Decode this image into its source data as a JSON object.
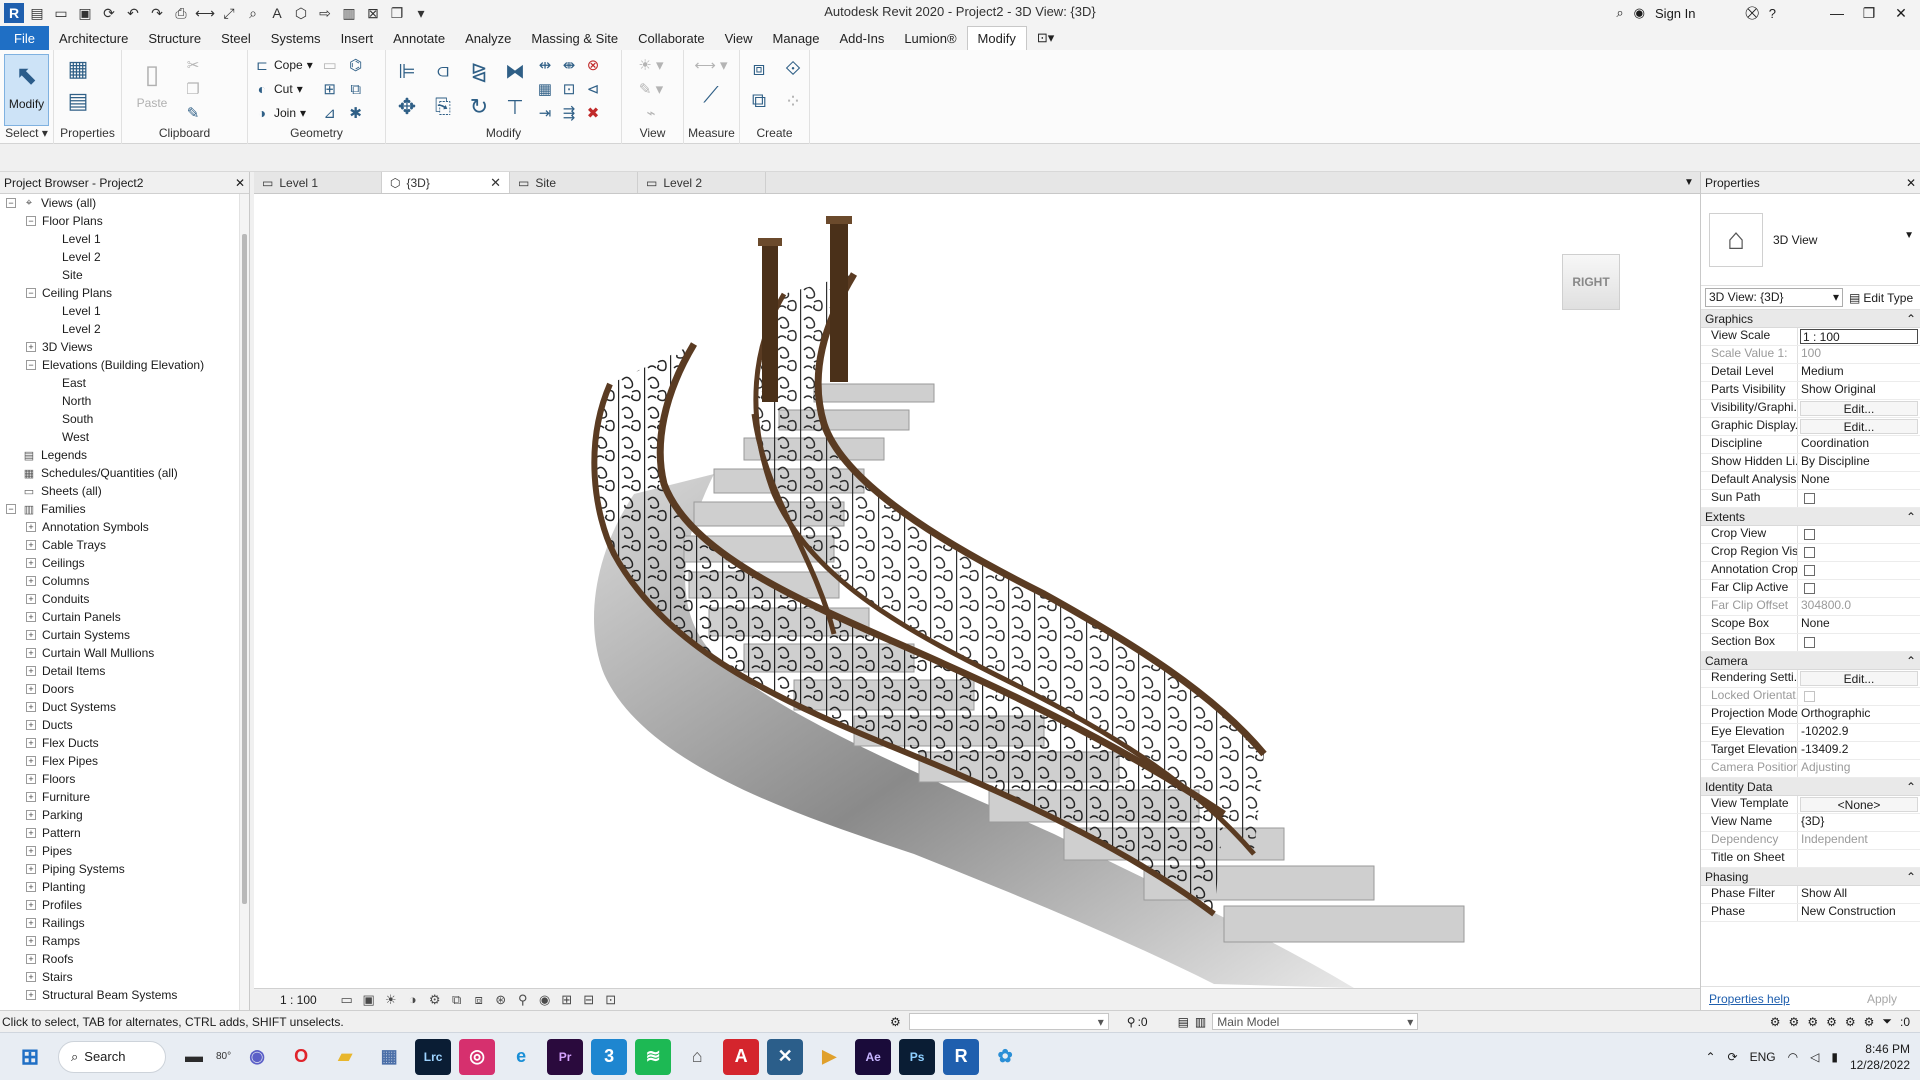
{
  "titlebar": {
    "title": "Autodesk Revit 2020 - Project2 - 3D View: {3D}",
    "sign_in": "Sign In"
  },
  "menu": {
    "file": "File",
    "tabs": [
      "Architecture",
      "Structure",
      "Steel",
      "Systems",
      "Insert",
      "Annotate",
      "Analyze",
      "Massing & Site",
      "Collaborate",
      "View",
      "Manage",
      "Add-Ins",
      "Lumion®",
      "Modify"
    ]
  },
  "ribbon": {
    "select": {
      "modify": "Modify",
      "label": "Select"
    },
    "properties": {
      "button": "Properties"
    },
    "clipboard": {
      "paste": "Paste",
      "label": "Clipboard"
    },
    "geometry": {
      "cope": "Cope",
      "cut": "Cut",
      "join": "Join",
      "label": "Geometry"
    },
    "modify": {
      "label": "Modify"
    },
    "view": {
      "label": "View"
    },
    "measure": {
      "label": "Measure"
    },
    "create": {
      "label": "Create"
    }
  },
  "project_browser": {
    "title": "Project Browser - Project2",
    "items": [
      {
        "label": "Views (all)",
        "level": 0,
        "toggle": "−",
        "icon": "views"
      },
      {
        "label": "Floor Plans",
        "level": 1,
        "toggle": "−"
      },
      {
        "label": "Level 1",
        "level": 2
      },
      {
        "label": "Level 2",
        "level": 2
      },
      {
        "label": "Site",
        "level": 2
      },
      {
        "label": "Ceiling Plans",
        "level": 1,
        "toggle": "−"
      },
      {
        "label": "Level 1",
        "level": 2
      },
      {
        "label": "Level 2",
        "level": 2
      },
      {
        "label": "3D Views",
        "level": 1,
        "toggle": "+"
      },
      {
        "label": "Elevations (Building Elevation)",
        "level": 1,
        "toggle": "−"
      },
      {
        "label": "East",
        "level": 2
      },
      {
        "label": "North",
        "level": 2
      },
      {
        "label": "South",
        "level": 2
      },
      {
        "label": "West",
        "level": 2
      },
      {
        "label": "Legends",
        "level": 0,
        "icon": "legend"
      },
      {
        "label": "Schedules/Quantities (all)",
        "level": 0,
        "icon": "schedule"
      },
      {
        "label": "Sheets (all)",
        "level": 0,
        "icon": "sheet"
      },
      {
        "label": "Families",
        "level": 0,
        "toggle": "−",
        "icon": "family"
      },
      {
        "label": "Annotation Symbols",
        "level": 1,
        "toggle": "+"
      },
      {
        "label": "Cable Trays",
        "level": 1,
        "toggle": "+"
      },
      {
        "label": "Ceilings",
        "level": 1,
        "toggle": "+"
      },
      {
        "label": "Columns",
        "level": 1,
        "toggle": "+"
      },
      {
        "label": "Conduits",
        "level": 1,
        "toggle": "+"
      },
      {
        "label": "Curtain Panels",
        "level": 1,
        "toggle": "+"
      },
      {
        "label": "Curtain Systems",
        "level": 1,
        "toggle": "+"
      },
      {
        "label": "Curtain Wall Mullions",
        "level": 1,
        "toggle": "+"
      },
      {
        "label": "Detail Items",
        "level": 1,
        "toggle": "+"
      },
      {
        "label": "Doors",
        "level": 1,
        "toggle": "+"
      },
      {
        "label": "Duct Systems",
        "level": 1,
        "toggle": "+"
      },
      {
        "label": "Ducts",
        "level": 1,
        "toggle": "+"
      },
      {
        "label": "Flex Ducts",
        "level": 1,
        "toggle": "+"
      },
      {
        "label": "Flex Pipes",
        "level": 1,
        "toggle": "+"
      },
      {
        "label": "Floors",
        "level": 1,
        "toggle": "+"
      },
      {
        "label": "Furniture",
        "level": 1,
        "toggle": "+"
      },
      {
        "label": "Parking",
        "level": 1,
        "toggle": "+"
      },
      {
        "label": "Pattern",
        "level": 1,
        "toggle": "+"
      },
      {
        "label": "Pipes",
        "level": 1,
        "toggle": "+"
      },
      {
        "label": "Piping Systems",
        "level": 1,
        "toggle": "+"
      },
      {
        "label": "Planting",
        "level": 1,
        "toggle": "+"
      },
      {
        "label": "Profiles",
        "level": 1,
        "toggle": "+"
      },
      {
        "label": "Railings",
        "level": 1,
        "toggle": "+"
      },
      {
        "label": "Ramps",
        "level": 1,
        "toggle": "+"
      },
      {
        "label": "Roofs",
        "level": 1,
        "toggle": "+"
      },
      {
        "label": "Stairs",
        "level": 1,
        "toggle": "+"
      },
      {
        "label": "Structural Beam Systems",
        "level": 1,
        "toggle": "+"
      }
    ]
  },
  "view_tabs": [
    {
      "label": "Level 1",
      "active": false
    },
    {
      "label": "{3D}",
      "active": true
    },
    {
      "label": "Site",
      "active": false
    },
    {
      "label": "Level 2",
      "active": false
    }
  ],
  "viewcube": {
    "face": "RIGHT"
  },
  "view_control": {
    "scale": "1 : 100"
  },
  "properties": {
    "title": "Properties",
    "type_name": "3D View",
    "selector": "3D View: {3D}",
    "edit_type": "Edit Type",
    "sections": [
      {
        "name": "Graphics",
        "rows": [
          {
            "key": "View Scale",
            "value": "1 : 100",
            "kind": "boxed"
          },
          {
            "key": "Scale Value    1:",
            "value": "100",
            "dim": true
          },
          {
            "key": "Detail Level",
            "value": "Medium"
          },
          {
            "key": "Parts Visibility",
            "value": "Show Original"
          },
          {
            "key": "Visibility/Graphi...",
            "value": "Edit...",
            "kind": "btn"
          },
          {
            "key": "Graphic Display...",
            "value": "Edit...",
            "kind": "btn"
          },
          {
            "key": "Discipline",
            "value": "Coordination"
          },
          {
            "key": "Show Hidden Li...",
            "value": "By Discipline"
          },
          {
            "key": "Default Analysis...",
            "value": "None"
          },
          {
            "key": "Sun Path",
            "value": "",
            "kind": "check"
          }
        ]
      },
      {
        "name": "Extents",
        "rows": [
          {
            "key": "Crop View",
            "value": "",
            "kind": "check"
          },
          {
            "key": "Crop Region Vis...",
            "value": "",
            "kind": "check"
          },
          {
            "key": "Annotation Crop",
            "value": "",
            "kind": "check"
          },
          {
            "key": "Far Clip Active",
            "value": "",
            "kind": "check"
          },
          {
            "key": "Far Clip Offset",
            "value": "304800.0",
            "dim": true
          },
          {
            "key": "Scope Box",
            "value": "None"
          },
          {
            "key": "Section Box",
            "value": "",
            "kind": "check"
          }
        ]
      },
      {
        "name": "Camera",
        "rows": [
          {
            "key": "Rendering Setti...",
            "value": "Edit...",
            "kind": "btn"
          },
          {
            "key": "Locked Orientat...",
            "value": "",
            "kind": "check",
            "dim": true
          },
          {
            "key": "Projection Mode",
            "value": "Orthographic"
          },
          {
            "key": "Eye Elevation",
            "value": "-10202.9"
          },
          {
            "key": "Target Elevation",
            "value": "-13409.2"
          },
          {
            "key": "Camera Position",
            "value": "Adjusting",
            "dim": true
          }
        ]
      },
      {
        "name": "Identity Data",
        "rows": [
          {
            "key": "View Template",
            "value": "<None>",
            "kind": "btn"
          },
          {
            "key": "View Name",
            "value": "{3D}"
          },
          {
            "key": "Dependency",
            "value": "Independent",
            "dim": true
          },
          {
            "key": "Title on Sheet",
            "value": ""
          }
        ]
      },
      {
        "name": "Phasing",
        "rows": [
          {
            "key": "Phase Filter",
            "value": "Show All"
          },
          {
            "key": "Phase",
            "value": "New Construction"
          }
        ]
      }
    ],
    "help": "Properties help",
    "apply": "Apply"
  },
  "statusbar": {
    "message": "Click to select, TAB for alternates, CTRL adds, SHIFT unselects.",
    "count": ":0",
    "model": "Main Model",
    "filter_count": ":0"
  },
  "taskbar": {
    "search": "Search",
    "weather": "80°",
    "lang": "ENG",
    "time": "8:46 PM",
    "date": "12/28/2022",
    "apps": [
      {
        "name": "file-explorer",
        "glyph": "▬",
        "color": "#2b2b2b",
        "bg": "transparent"
      },
      {
        "name": "teams",
        "glyph": "◉",
        "color": "#5b5fc7",
        "bg": "transparent"
      },
      {
        "name": "opera",
        "glyph": "O",
        "color": "#e0232b",
        "bg": "transparent"
      },
      {
        "name": "folder",
        "glyph": "▰",
        "color": "#e8b62c",
        "bg": "transparent"
      },
      {
        "name": "chart-app",
        "glyph": "▦",
        "color": "#4b6fa8",
        "bg": "transparent"
      },
      {
        "name": "lightroom",
        "glyph": "Lrc",
        "color": "#9ed3ff",
        "bg": "#0a1d34"
      },
      {
        "name": "instagram",
        "glyph": "◎",
        "color": "#fff",
        "bg": "#d6306e"
      },
      {
        "name": "edge",
        "glyph": "e",
        "color": "#1a8fd6",
        "bg": "transparent"
      },
      {
        "name": "premiere",
        "glyph": "Pr",
        "color": "#d6a3ff",
        "bg": "#2a0a3d"
      },
      {
        "name": "app-3",
        "glyph": "3",
        "color": "#fff",
        "bg": "#1e86d0"
      },
      {
        "name": "spotify",
        "glyph": "≋",
        "color": "#fff",
        "bg": "#1db954"
      },
      {
        "name": "app-hat",
        "glyph": "⌂",
        "color": "#555",
        "bg": "transparent"
      },
      {
        "name": "acrobat",
        "glyph": "A",
        "color": "#fff",
        "bg": "#d4252d"
      },
      {
        "name": "app-x",
        "glyph": "✕",
        "color": "#fff",
        "bg": "#2b5e8a"
      },
      {
        "name": "app-play",
        "glyph": "▶",
        "color": "#e0a02b",
        "bg": "transparent"
      },
      {
        "name": "after-effects",
        "glyph": "Ae",
        "color": "#c7b5ff",
        "bg": "#1a0b3a"
      },
      {
        "name": "photoshop",
        "glyph": "Ps",
        "color": "#8fd0ff",
        "bg": "#0a1d34"
      },
      {
        "name": "revit",
        "glyph": "R",
        "color": "#fff",
        "bg": "#1f5fae"
      },
      {
        "name": "globe-app",
        "glyph": "✿",
        "color": "#2a8fd6",
        "bg": "transparent"
      }
    ]
  }
}
